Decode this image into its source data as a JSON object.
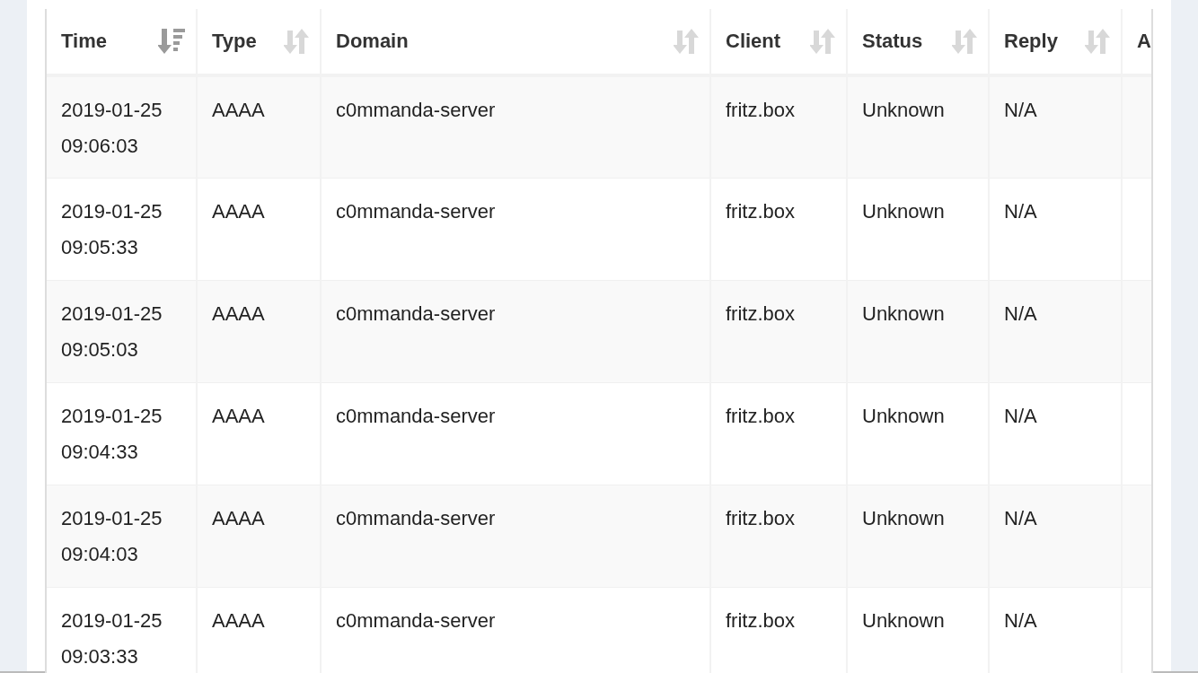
{
  "table": {
    "columns": [
      {
        "label": "Time",
        "sorted": true
      },
      {
        "label": "Type",
        "sorted": false
      },
      {
        "label": "Domain",
        "sorted": false
      },
      {
        "label": "Client",
        "sorted": false
      },
      {
        "label": "Status",
        "sorted": false
      },
      {
        "label": "Reply",
        "sorted": false
      },
      {
        "label": "A"
      }
    ],
    "rows": [
      {
        "time": [
          "2019-01-25",
          "09:06:03"
        ],
        "type": "AAAA",
        "domain": "c0mmanda-server",
        "client": "fritz.box",
        "status": "Unknown",
        "reply": "N/A"
      },
      {
        "time": [
          "2019-01-25",
          "09:05:33"
        ],
        "type": "AAAA",
        "domain": "c0mmanda-server",
        "client": "fritz.box",
        "status": "Unknown",
        "reply": "N/A"
      },
      {
        "time": [
          "2019-01-25",
          "09:05:03"
        ],
        "type": "AAAA",
        "domain": "c0mmanda-server",
        "client": "fritz.box",
        "status": "Unknown",
        "reply": "N/A"
      },
      {
        "time": [
          "2019-01-25",
          "09:04:33"
        ],
        "type": "AAAA",
        "domain": "c0mmanda-server",
        "client": "fritz.box",
        "status": "Unknown",
        "reply": "N/A"
      },
      {
        "time": [
          "2019-01-25",
          "09:04:03"
        ],
        "type": "AAAA",
        "domain": "c0mmanda-server",
        "client": "fritz.box",
        "status": "Unknown",
        "reply": "N/A"
      },
      {
        "time": [
          "2019-01-25",
          "09:03:33"
        ],
        "type": "AAAA",
        "domain": "c0mmanda-server",
        "client": "fritz.box",
        "status": "Unknown",
        "reply": "N/A"
      }
    ]
  }
}
